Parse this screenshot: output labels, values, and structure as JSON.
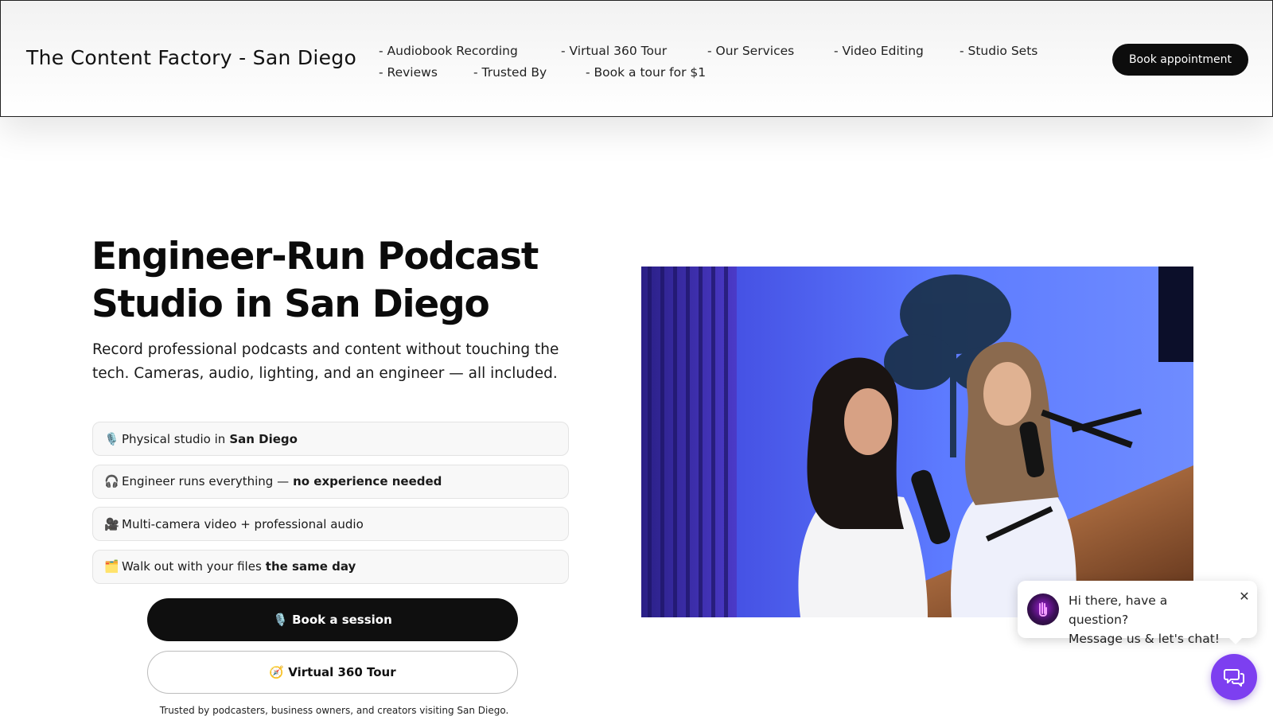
{
  "header": {
    "brand": "The Content Factory - San Diego",
    "nav_rows": [
      [
        "- Audiobook Recording",
        "- Virtual 360 Tour",
        "- Our Services",
        "- Video Editing",
        "- Studio Sets"
      ],
      [
        "- Reviews",
        "- Trusted By",
        "- Book a tour for $1"
      ]
    ],
    "book_label": "Book appointment"
  },
  "hero": {
    "title_line1": "Engineer-Run Podcast",
    "title_line2": "Studio in San Diego",
    "subtitle": "Record professional podcasts and content without touching the tech. Cameras, audio, lighting, and an engineer — all included.",
    "features": [
      {
        "emoji": "🎙️",
        "text": "Physical studio in",
        "bold": "San Diego"
      },
      {
        "emoji": "🎧",
        "text": "Engineer runs everything —",
        "bold": "no experience needed"
      },
      {
        "emoji": "🎥",
        "text": "Multi-camera video + professional audio",
        "bold": ""
      },
      {
        "emoji": "🗂️",
        "text": "Walk out with your files",
        "bold": "the same day"
      }
    ],
    "cta_primary": "🎙️ Book a session",
    "cta_secondary": "🧭 Virtual 360 Tour",
    "trusted": "Trusted by podcasters, business owners, and creators visiting San Diego."
  },
  "photo": {
    "icon": "studio-photo"
  },
  "chat": {
    "line1": "Hi there, have a question?",
    "line2": "Message us & let's chat!",
    "close": "✕",
    "accent": "#7d3ff0"
  }
}
